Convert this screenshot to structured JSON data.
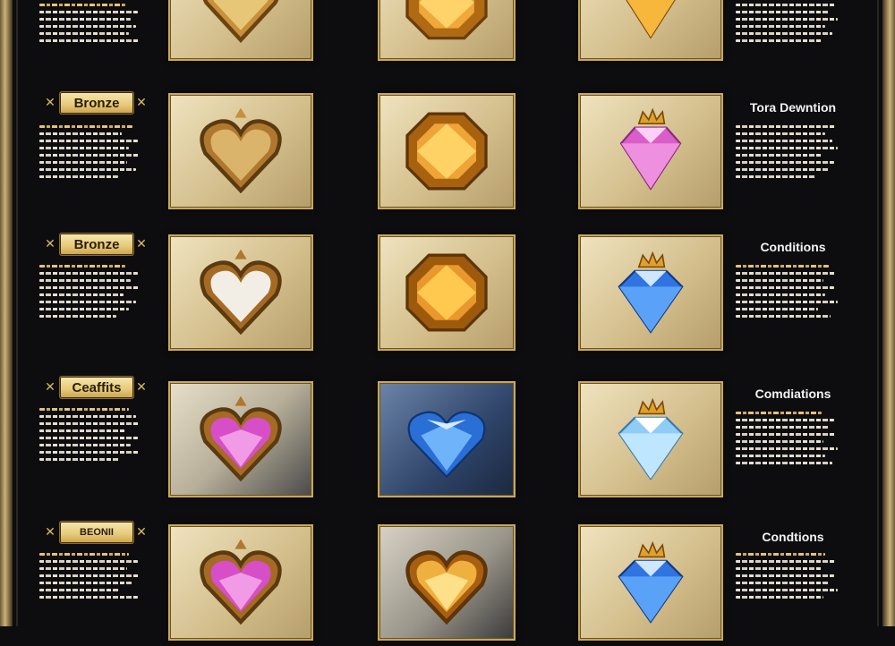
{
  "rows": [
    {
      "badge": "",
      "right_title": "",
      "gems": [
        "heart-bronze",
        "octagon-gold",
        "diamond-gold"
      ]
    },
    {
      "badge": "Bronze",
      "right_title": "Tora Dewntion",
      "gems": [
        "heart-bronze",
        "octagon-gold",
        "diamond-pink-crowned"
      ]
    },
    {
      "badge": "Bronze",
      "right_title": "Conditions",
      "gems": [
        "heart-silver",
        "octagon-gold",
        "diamond-blue-crowned"
      ]
    },
    {
      "badge": "Ceaffits",
      "right_title": "Comdiations",
      "gems": [
        "heart-pink",
        "heart-blue-diamond",
        "diamond-iceblue-crowned"
      ]
    },
    {
      "badge": "BEONII",
      "right_title": "Condtions",
      "gems": [
        "heart-pink",
        "heart-gold",
        "diamond-blue-crowned"
      ]
    }
  ],
  "colors": {
    "gold": "#d9b965",
    "pink": "#e86bd8",
    "blue": "#3f8df0",
    "ice": "#bfe6ff",
    "bronze": "#c8903a"
  }
}
